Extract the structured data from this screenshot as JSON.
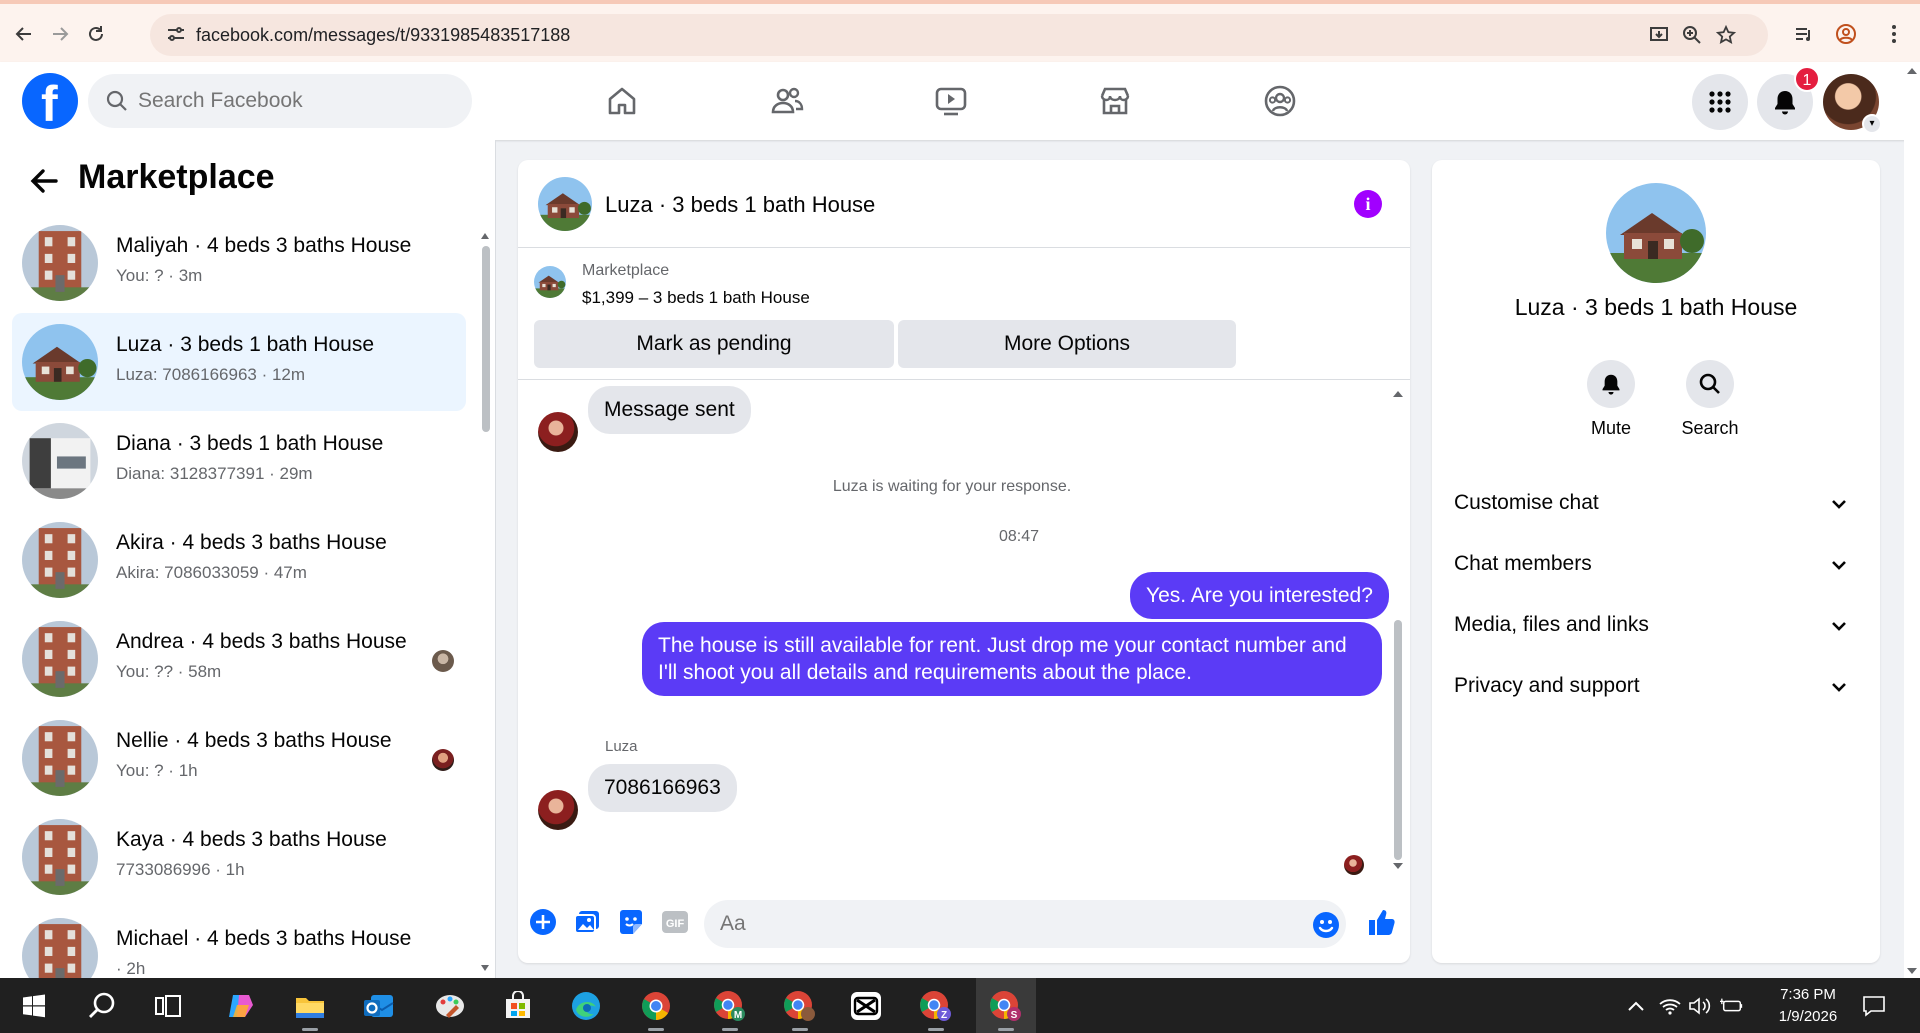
{
  "browser": {
    "url": "facebook.com/messages/t/9331985483517188",
    "icons": [
      "back-icon",
      "forward-icon",
      "reload-icon",
      "site-settings-icon",
      "install-icon",
      "zoom-icon",
      "bookmark-star-icon",
      "media-control-icon",
      "profile-icon",
      "menu-icon"
    ]
  },
  "header": {
    "search_placeholder": "Search Facebook",
    "notification_count": "1",
    "nav_icons": [
      "home-icon",
      "friends-icon",
      "watch-icon",
      "marketplace-icon",
      "groups-icon"
    ]
  },
  "sidebar": {
    "title": "Marketplace",
    "conversations": [
      {
        "name": "Maliyah · 4 beds 3 baths House",
        "preview": "You: ? · 3m",
        "active": false,
        "seen": false
      },
      {
        "name": "Luza · 3 beds 1 bath House",
        "preview": "Luza: 7086166963 · 12m",
        "active": true,
        "seen": false
      },
      {
        "name": "Diana · 3 beds 1 bath House",
        "preview": "Diana: 3128377391 · 29m",
        "active": false,
        "seen": false
      },
      {
        "name": "Akira · 4 beds 3 baths House",
        "preview": "Akira: 7086033059 · 47m",
        "active": false,
        "seen": false
      },
      {
        "name": "Andrea · 4 beds 3 baths House",
        "preview": "You: ?? · 58m",
        "active": false,
        "seen": true
      },
      {
        "name": "Nellie · 4 beds 3 baths House",
        "preview": "You: ? · 1h",
        "active": false,
        "seen": true
      },
      {
        "name": "Kaya · 4 beds 3 baths House",
        "preview": "7733086996 · 1h",
        "active": false,
        "seen": false
      },
      {
        "name": "Michael · 4 beds 3 baths House",
        "preview": " · 2h",
        "active": false,
        "seen": false
      }
    ]
  },
  "chat": {
    "title": "Luza · 3 beds 1 bath House",
    "listing": {
      "source": "Marketplace",
      "price_line": "$1,399 – 3 beds 1 bath House",
      "mark_pending_label": "Mark as pending",
      "more_options_label": "More Options"
    },
    "messages": {
      "message_sent": "Message sent",
      "waiting_notice": "Luza is waiting for your response.",
      "timestamp": "08:47",
      "out_1": "Yes. Are you interested?",
      "out_2": "The house is still available for rent. Just drop me your contact number and I'll shoot you all details and requirements about the place.",
      "sender_name": "Luza",
      "in_1": "7086166963"
    },
    "composer_placeholder": "Aa"
  },
  "info_panel": {
    "title": "Luza · 3 beds 1 bath House",
    "actions": {
      "mute": "Mute",
      "search": "Search"
    },
    "sections": [
      "Customise chat",
      "Chat members",
      "Media, files and links",
      "Privacy and support"
    ]
  },
  "taskbar": {
    "time": "7:36 PM",
    "date": "1/9/2026"
  }
}
